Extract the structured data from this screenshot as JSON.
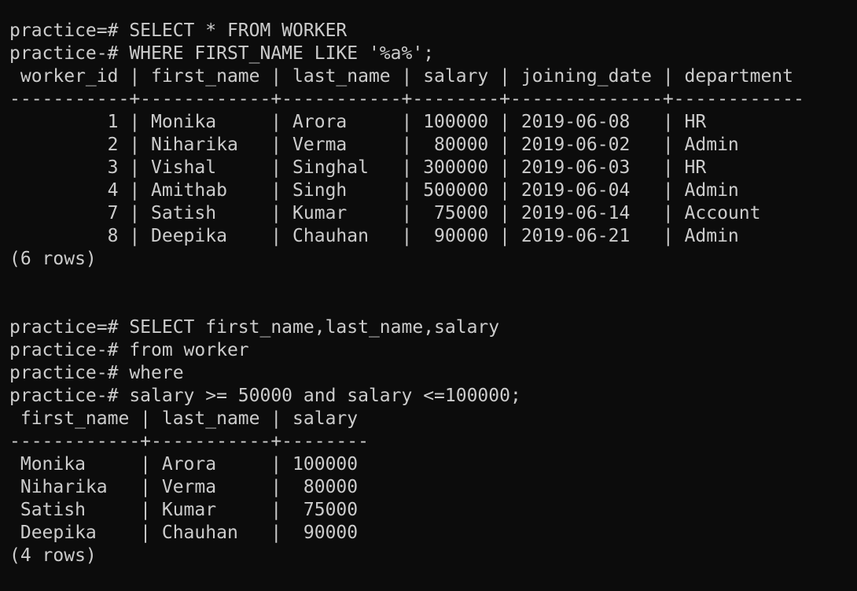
{
  "terminal": {
    "query1": {
      "prompt_lines": [
        "practice=# SELECT * FROM WORKER",
        "practice-# WHERE FIRST_NAME LIKE '%a%';"
      ],
      "header": " worker_id | first_name | last_name | salary | joining_date | department",
      "separator": "-----------+------------+-----------+--------+--------------+------------",
      "columns": [
        "worker_id",
        "first_name",
        "last_name",
        "salary",
        "joining_date",
        "department"
      ],
      "rows": [
        "         1 | Monika     | Arora     | 100000 | 2019-06-08   | HR",
        "         2 | Niharika   | Verma     |  80000 | 2019-06-02   | Admin",
        "         3 | Vishal     | Singhal   | 300000 | 2019-06-03   | HR",
        "         4 | Amithab    | Singh     | 500000 | 2019-06-04   | Admin",
        "         7 | Satish     | Kumar     |  75000 | 2019-06-14   | Account",
        "         8 | Deepika    | Chauhan   |  90000 | 2019-06-21   | Admin"
      ],
      "row_count": "(6 rows)"
    },
    "query2": {
      "prompt_lines": [
        "practice=# SELECT first_name,last_name,salary",
        "practice-# from worker",
        "practice-# where",
        "practice-# salary >= 50000 and salary <=100000;"
      ],
      "header": " first_name | last_name | salary",
      "separator": "------------+-----------+--------",
      "columns": [
        "first_name",
        "last_name",
        "salary"
      ],
      "rows": [
        " Monika     | Arora     | 100000",
        " Niharika   | Verma     |  80000",
        " Satish     | Kumar     |  75000",
        " Deepika    | Chauhan   |  90000"
      ],
      "row_count": "(4 rows)"
    }
  },
  "colors": {
    "background": "#0c0c0c",
    "text": "#cccccc"
  }
}
